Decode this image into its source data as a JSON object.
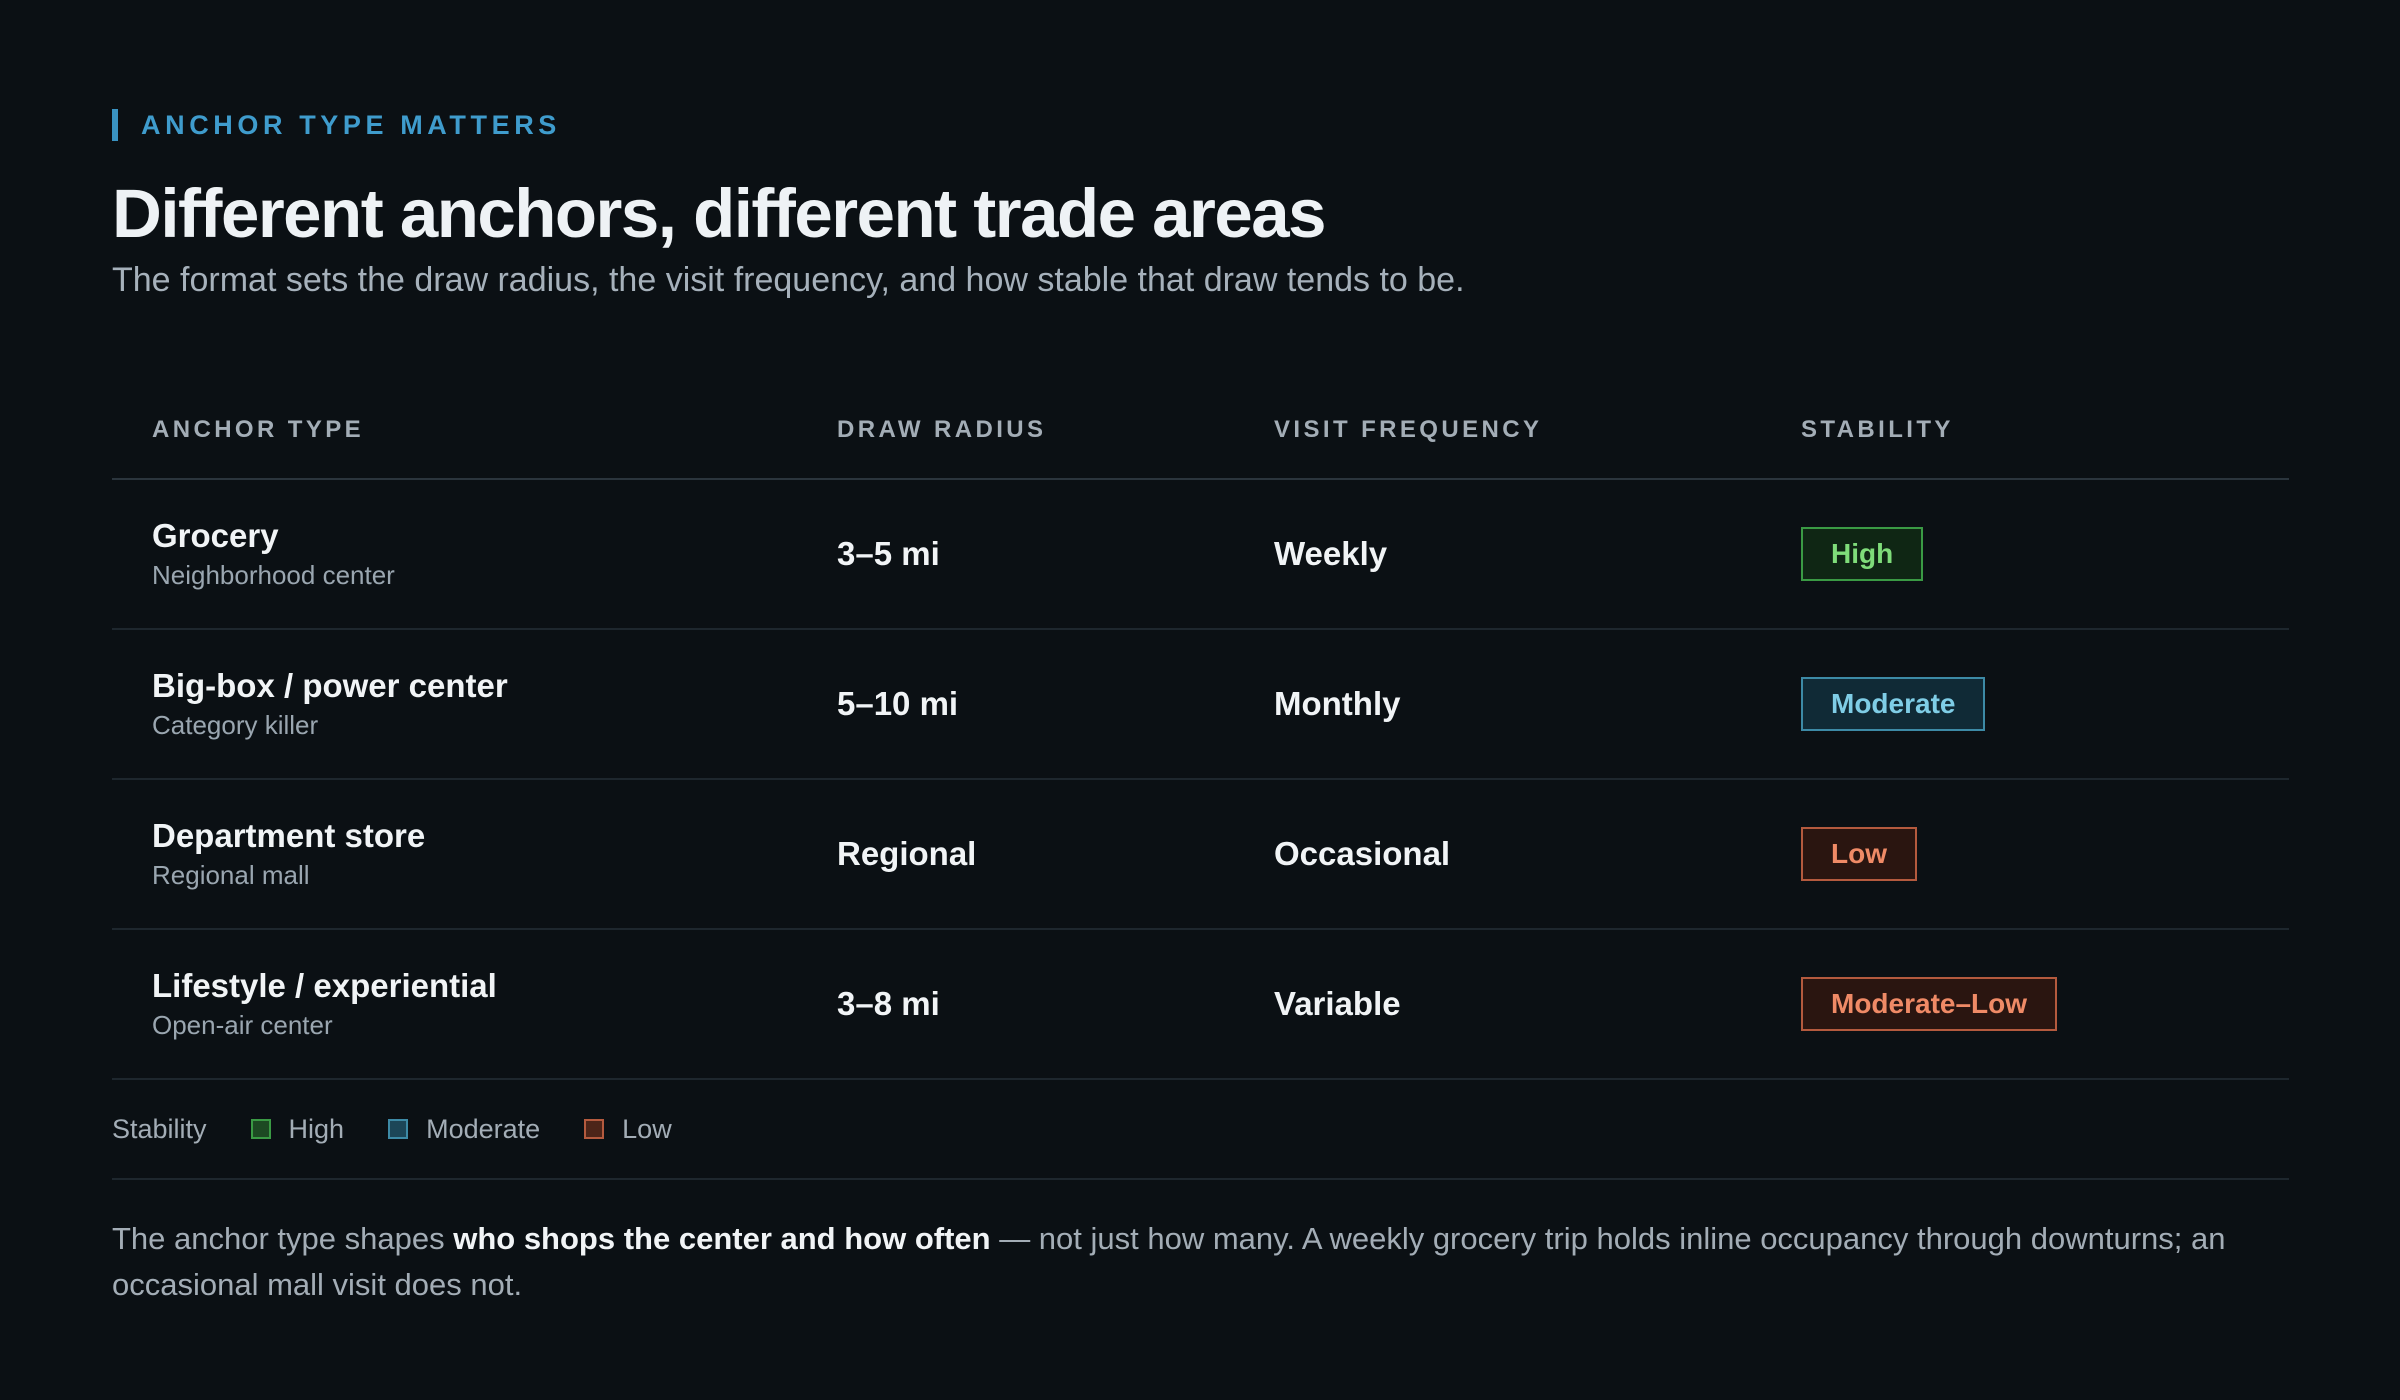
{
  "header": {
    "eyebrow": "ANCHOR TYPE MATTERS",
    "title": "Different anchors, different trade areas",
    "subtitle": "The format sets the draw radius, the visit frequency, and how stable that draw tends to be."
  },
  "table": {
    "columns": [
      "ANCHOR TYPE",
      "DRAW RADIUS",
      "VISIT FREQUENCY",
      "STABILITY"
    ],
    "rows": [
      {
        "name": "Grocery",
        "sub": "Neighborhood center",
        "radius": "3–5 mi",
        "frequency": "Weekly",
        "stability": "High",
        "level": "high"
      },
      {
        "name": "Big‑box / power center",
        "sub": "Category killer",
        "radius": "5–10 mi",
        "frequency": "Monthly",
        "stability": "Moderate",
        "level": "moderate"
      },
      {
        "name": "Department store",
        "sub": "Regional mall",
        "radius": "Regional",
        "frequency": "Occasional",
        "stability": "Low",
        "level": "low"
      },
      {
        "name": "Lifestyle / experiential",
        "sub": "Open‑air center",
        "radius": "3–8 mi",
        "frequency": "Variable",
        "stability": "Moderate–Low",
        "level": "low"
      }
    ]
  },
  "legend": {
    "title": "Stability",
    "items": [
      {
        "label": "High",
        "level": "high"
      },
      {
        "label": "Moderate",
        "level": "moderate"
      },
      {
        "label": "Low",
        "level": "low"
      }
    ]
  },
  "footnote": {
    "pre": "The anchor type shapes ",
    "bold": "who shops the center and how often",
    "post": " — not just how many. A weekly grocery trip holds inline occupancy through downturns; an occasional mall visit does not."
  },
  "colors": {
    "accent": "#3f9ccd",
    "high": "#7fdc7a",
    "moderate": "#7fcde6",
    "low": "#ef8a66",
    "background": "#0b1014"
  }
}
